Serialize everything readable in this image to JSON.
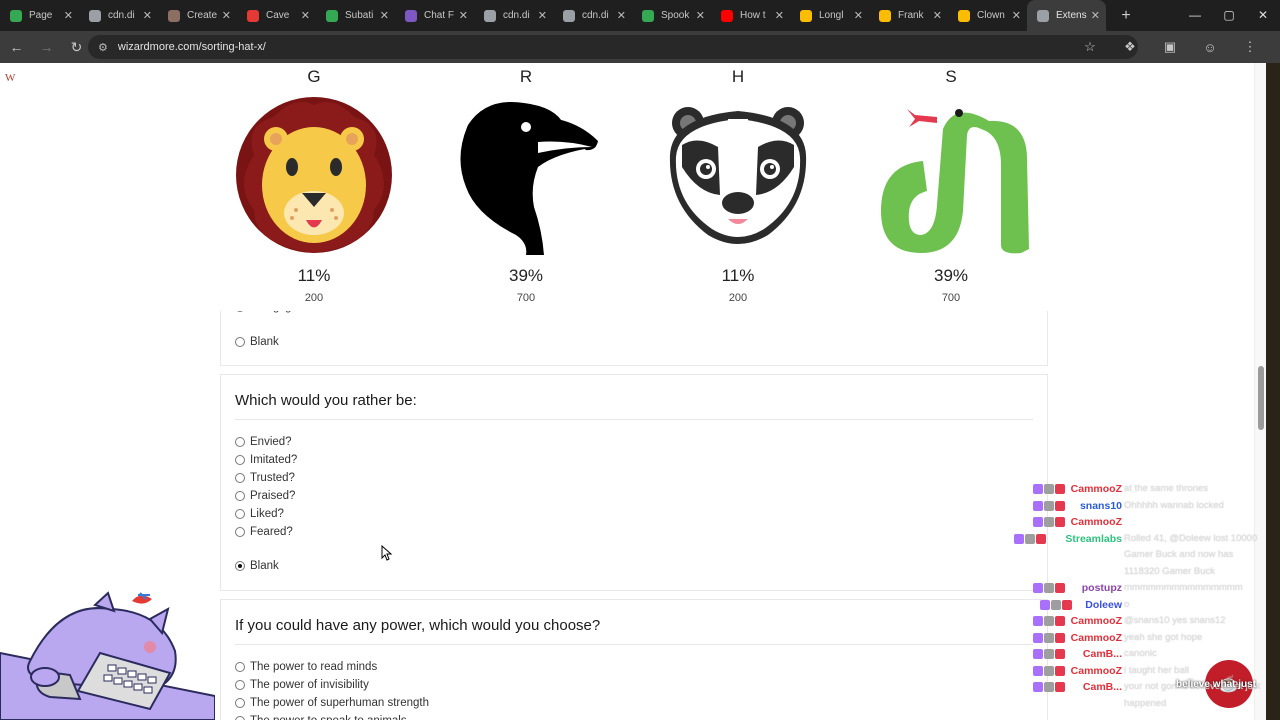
{
  "browser": {
    "tabs": [
      {
        "title": "Page",
        "favicon_color": "#34a853"
      },
      {
        "title": "cdn.di",
        "favicon_color": "#9aa0a6"
      },
      {
        "title": "Create",
        "favicon_color": "#8d6e63"
      },
      {
        "title": "Cave",
        "favicon_color": "#e53935"
      },
      {
        "title": "Subati",
        "favicon_color": "#34a853"
      },
      {
        "title": "Chat F",
        "favicon_color": "#7e57c2"
      },
      {
        "title": "cdn.di",
        "favicon_color": "#9aa0a6"
      },
      {
        "title": "cdn.di",
        "favicon_color": "#9aa0a6"
      },
      {
        "title": "Spook",
        "favicon_color": "#34a853"
      },
      {
        "title": "How t",
        "favicon_color": "#ff0000"
      },
      {
        "title": "Longl",
        "favicon_color": "#fbbc04"
      },
      {
        "title": "Frank",
        "favicon_color": "#fbbc04"
      },
      {
        "title": "Clown",
        "favicon_color": "#fbbc04"
      },
      {
        "title": "Extens",
        "favicon_color": "#9aa0a6"
      }
    ],
    "url": "wizardmore.com/sorting-hat-x/"
  },
  "site": {
    "logo": "W"
  },
  "houses": [
    {
      "letter": "G",
      "percent": "11%",
      "count": "200",
      "icon": "lion-icon"
    },
    {
      "letter": "R",
      "percent": "39%",
      "count": "700",
      "icon": "raven-icon"
    },
    {
      "letter": "H",
      "percent": "11%",
      "count": "200",
      "icon": "badger-icon"
    },
    {
      "letter": "S",
      "percent": "39%",
      "count": "700",
      "icon": "snake-icon"
    }
  ],
  "previous_question": {
    "partial_option": "Being ignored",
    "blank_label": "Blank"
  },
  "question1": {
    "text": "Which would you rather be:",
    "options": [
      "Envied?",
      "Imitated?",
      "Trusted?",
      "Praised?",
      "Liked?",
      "Feared?"
    ],
    "blank_label": "Blank",
    "selected": "Blank"
  },
  "question2": {
    "text": "If you could have any power, which would you choose?",
    "options": [
      "The power to read minds",
      "The power of invisibility",
      "The power of superhuman strength",
      "The power to speak to animals"
    ]
  },
  "chat": [
    {
      "name": "CammooZ",
      "color": "#e0303a",
      "msg": "at the same thrones"
    },
    {
      "name": "snans10",
      "color": "#2a5bd7",
      "msg": "Ohhhhh wannab locked"
    },
    {
      "name": "CammooZ",
      "color": "#e0303a",
      "msg": ""
    },
    {
      "name": "Streamlabs",
      "color": "#2ec27e",
      "msg": "Rolled 41, @Doleew lost 10000"
    },
    {
      "name": "",
      "color": "#ffffff",
      "msg": "Gamer Buck and now has"
    },
    {
      "name": "",
      "color": "#ffffff",
      "msg": "1118320 Gamer Buck"
    },
    {
      "name": "postupz",
      "color": "#8e44ad",
      "msg": "mmmmmmmmmmmmmmm"
    },
    {
      "name": "Doleew",
      "color": "#3a50e0",
      "msg": "o"
    },
    {
      "name": "CammooZ",
      "color": "#e0303a",
      "msg": "@snans10 yes snans12"
    },
    {
      "name": "CammooZ",
      "color": "#e0303a",
      "msg": "yeah she got hope"
    },
    {
      "name": "CamB...",
      "color": "#e0303a",
      "msg": "canonic"
    },
    {
      "name": "CammooZ",
      "color": "#e0303a",
      "msg": "i taught her ball"
    },
    {
      "name": "CamB...",
      "color": "#e0303a",
      "msg": "your not gonna believe what just"
    },
    {
      "name": "",
      "color": "#ffffff",
      "msg": "happened"
    }
  ],
  "fab": {
    "label": "believe what just"
  }
}
